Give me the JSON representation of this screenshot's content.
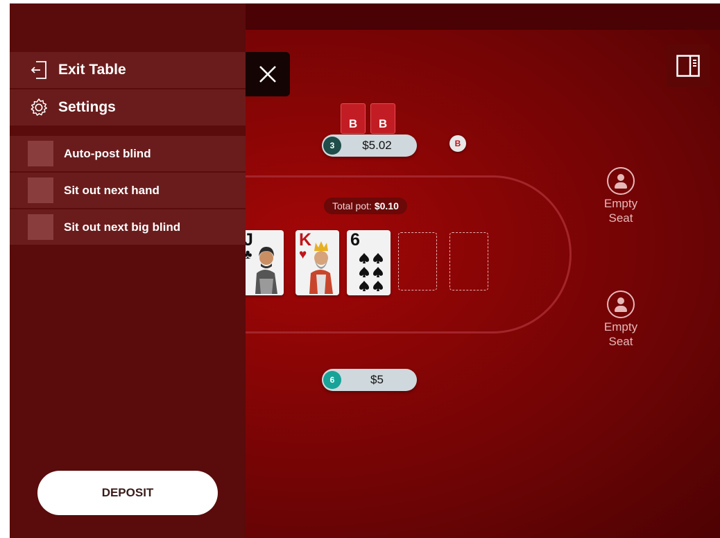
{
  "menu": {
    "exit_label": "Exit Table",
    "settings_label": "Settings",
    "close_icon": "close-icon",
    "options": [
      {
        "label": "Auto-post blind",
        "checked": false
      },
      {
        "label": "Sit out next hand",
        "checked": false
      },
      {
        "label": "Sit out next big blind",
        "checked": false
      }
    ],
    "deposit_label": "DEPOSIT"
  },
  "table": {
    "pot_label": "Total pot:",
    "pot_value": "$0.10",
    "dealer_marker": "B",
    "players": [
      {
        "seat": "3",
        "stack": "$5.02",
        "card_backs": [
          "B",
          "B"
        ]
      },
      {
        "seat": "6",
        "stack": "$5"
      }
    ],
    "board": [
      {
        "rank": "J",
        "suit": "♣"
      },
      {
        "rank": "K",
        "suit": "♥"
      },
      {
        "rank": "6",
        "suit": "♠"
      }
    ],
    "empty_seats": [
      {
        "label_line1": "Empty",
        "label_line2": "Seat"
      },
      {
        "label_line1": "Empty",
        "label_line2": "Seat"
      }
    ]
  },
  "colors": {
    "felt": "#8a0505",
    "panel": "#5a0b0b",
    "menu_row": "#6a1c1c",
    "seat3_badge": "#1e4d4a",
    "seat6_badge": "#17a398"
  }
}
